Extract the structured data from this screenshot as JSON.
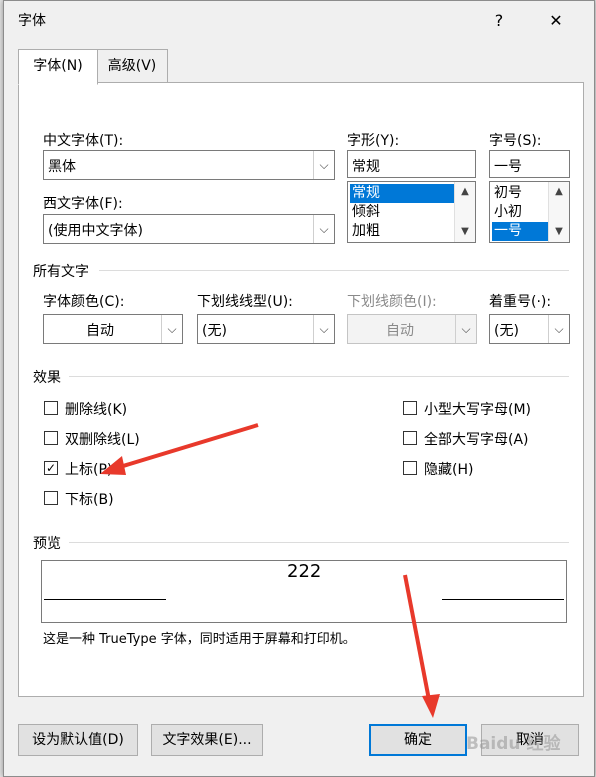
{
  "dialog": {
    "title": "字体",
    "help_label": "?",
    "close_label": "✕"
  },
  "tabs": [
    {
      "label": "字体(N)"
    },
    {
      "label": "高级(V)"
    }
  ],
  "font": {
    "chinese_label": "中文字体(T):",
    "chinese_value": "黑体",
    "western_label": "西文字体(F):",
    "western_value": "(使用中文字体)",
    "style_label": "字形(Y):",
    "style_value": "常规",
    "style_items": [
      "常规",
      "倾斜",
      "加粗"
    ],
    "size_label": "字号(S):",
    "size_value": "一号",
    "size_items": [
      "初号",
      "小初",
      "一号"
    ]
  },
  "all_text": {
    "section_label": "所有文字",
    "color_label": "字体颜色(C):",
    "color_value": "自动",
    "underline_label": "下划线线型(U):",
    "underline_value": "(无)",
    "underline_color_label": "下划线颜色(I):",
    "underline_color_value": "自动",
    "emphasis_label": "着重号(·):",
    "emphasis_value": "(无)"
  },
  "effects": {
    "section_label": "效果",
    "items": [
      {
        "label": "删除线(K)",
        "checked": false
      },
      {
        "label": "双删除线(L)",
        "checked": false
      },
      {
        "label": "上标(P)",
        "checked": true
      },
      {
        "label": "下标(B)",
        "checked": false
      },
      {
        "label": "小型大写字母(M)",
        "checked": false
      },
      {
        "label": "全部大写字母(A)",
        "checked": false
      },
      {
        "label": "隐藏(H)",
        "checked": false
      }
    ]
  },
  "preview": {
    "section_label": "预览",
    "sample_text": "222",
    "note": "这是一种 TrueType 字体，同时适用于屏幕和打印机。"
  },
  "buttons": {
    "set_default": "设为默认值(D)",
    "text_effects": "文字效果(E)...",
    "ok": "确定",
    "cancel": "取消"
  },
  "colors": {
    "selection": "#0078d7",
    "annotation_arrow": "#e8392b"
  },
  "watermark": "Baidu 经验"
}
